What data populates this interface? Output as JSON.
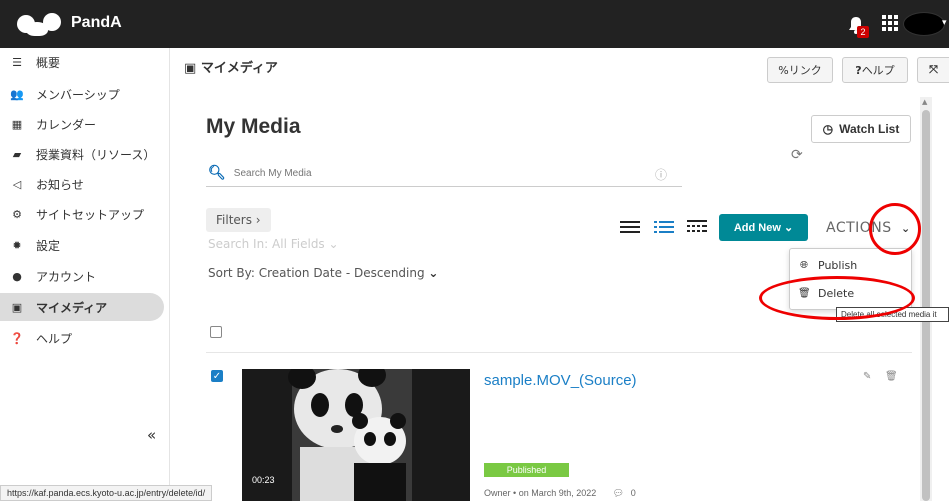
{
  "app": {
    "brand": "PandA",
    "notification_count": "2"
  },
  "sidebar": {
    "items": [
      {
        "label": "概要",
        "icon": "list-icon"
      },
      {
        "label": "メンバーシップ",
        "icon": "users-icon"
      },
      {
        "label": "カレンダー",
        "icon": "calendar-icon"
      },
      {
        "label": "授業資料（リソース）",
        "icon": "folder-icon"
      },
      {
        "label": "お知らせ",
        "icon": "bullhorn-icon"
      },
      {
        "label": "サイトセットアップ",
        "icon": "cogs-icon"
      },
      {
        "label": "設定",
        "icon": "gear-icon"
      },
      {
        "label": "アカウント",
        "icon": "user-icon"
      },
      {
        "label": "マイメディア",
        "icon": "media-icon",
        "active": true
      },
      {
        "label": "ヘルプ",
        "icon": "question-icon"
      }
    ],
    "collapse_label": "«"
  },
  "statusbar": {
    "url": "https://kaf.panda.ecs.kyoto-u.ac.jp/entry/delete/id/"
  },
  "header": {
    "title": "マイメディア",
    "link_label": "リンク",
    "help_label": "ヘルプ"
  },
  "main": {
    "title": "My Media",
    "watch_list_label": "Watch List",
    "search_placeholder": "Search My Media",
    "filters_label": "Filters  ›",
    "search_in": "Search In: All Fields",
    "sort_by": "Sort By: Creation Date - Descending",
    "add_new_label": "Add New",
    "actions_label": "ACTIONS"
  },
  "actions_menu": {
    "items": [
      {
        "label": "Publish",
        "icon": "globe-icon"
      },
      {
        "label": "Delete",
        "icon": "trash-icon"
      }
    ],
    "tooltip": "Delete all selected media it"
  },
  "media": [
    {
      "title": "sample.MOV_(Source)",
      "duration": "00:23",
      "status": "Published",
      "owner": "Owner",
      "date": "on March 9th, 2022",
      "comments": "0",
      "checked": true
    }
  ],
  "colors": {
    "topbar": "#222222",
    "accent": "#008996",
    "link": "#1b7fc6",
    "published": "#7ac943",
    "annotation": "#ee0000"
  }
}
